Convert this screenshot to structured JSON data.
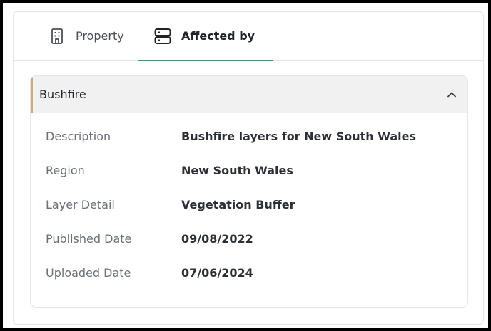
{
  "tabs": [
    {
      "label": "Property",
      "icon": "building-icon",
      "active": false
    },
    {
      "label": "Affected by",
      "icon": "server-stack-icon",
      "active": true
    }
  ],
  "accordion": {
    "title": "Bushfire",
    "expanded": true,
    "accent_color": "#d1a978",
    "fields": [
      {
        "label": "Description",
        "value": "Bushfire layers for New South Wales"
      },
      {
        "label": "Region",
        "value": "New South Wales"
      },
      {
        "label": "Layer Detail",
        "value": "Vegetation Buffer"
      },
      {
        "label": "Published Date",
        "value": "09/08/2022"
      },
      {
        "label": "Uploaded Date",
        "value": "07/06/2024"
      }
    ]
  },
  "colors": {
    "active_tab_underline": "#1f9d8a",
    "header_background": "#f1f1f1"
  }
}
